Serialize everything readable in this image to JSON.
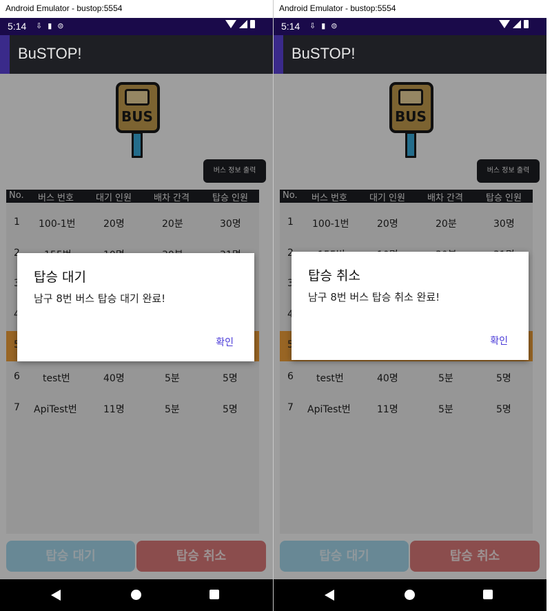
{
  "window_title": "Android Emulator - bustop:5554",
  "status_time": "5:14",
  "app_title": "BuSTOP!",
  "logo_text": "BUS",
  "info_button_label": "버스 정보 출력",
  "table": {
    "headers": [
      "No.",
      "버스 번호",
      "대기 인원",
      "배차 간격",
      "탑승 인원"
    ],
    "rows": [
      [
        "1",
        "100-1번",
        "20명",
        "20분",
        "30명"
      ],
      [
        "2",
        "155번",
        "10명",
        "30분",
        "31명"
      ],
      [
        "6",
        "test번",
        "40명",
        "5분",
        "5명"
      ],
      [
        "7",
        "ApiTest번",
        "11명",
        "5분",
        "5명"
      ]
    ],
    "partial_row_numbers": [
      "3",
      "4",
      "5"
    ]
  },
  "buttons": {
    "wait": "탑승 대기",
    "cancel": "탑승 취소"
  },
  "dialogs": [
    {
      "title": "탑승 대기",
      "message": "남구 8번 버스 탑승 대기 완료!",
      "ok": "확인"
    },
    {
      "title": "탑승 취소",
      "message": "남구 8번 버스 탑승 취소 완료!",
      "ok": "확인"
    }
  ],
  "colors": {
    "status_bar": "#1a0a4a",
    "app_bar": "#1e1f24",
    "highlight_row": "#f5a33a",
    "wait_button": "#a8dcf0",
    "cancel_button": "#e07d7d",
    "dialog_action": "#4a3ad8"
  }
}
